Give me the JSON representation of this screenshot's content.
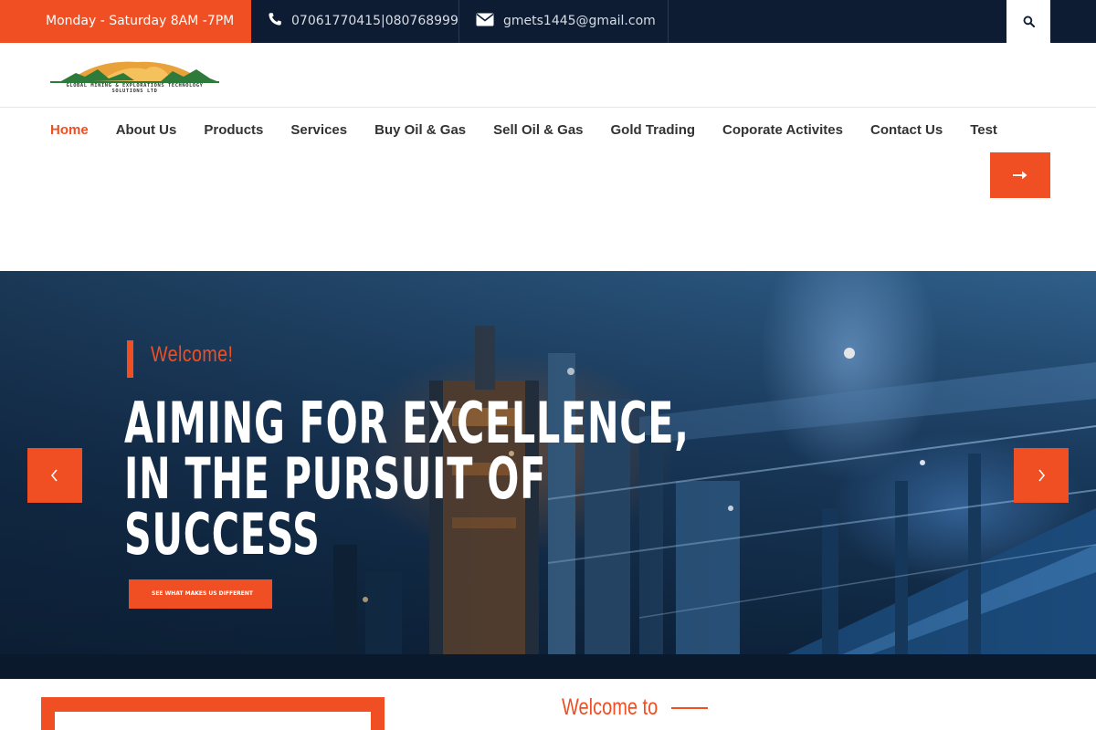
{
  "topbar": {
    "hours": "Monday - Saturday 8AM -7PM",
    "phone": "07061770415|080768999",
    "email": "gmets1445@gmail.com"
  },
  "logo": {
    "line1": "GLOBAL MINING & EXPLORATIONS TECHNOLOGY",
    "line2": "SOLUTIONS  LTD"
  },
  "nav": {
    "items": [
      {
        "label": "Home",
        "active": true
      },
      {
        "label": "About Us"
      },
      {
        "label": "Products"
      },
      {
        "label": "Services"
      },
      {
        "label": "Buy Oil & Gas"
      },
      {
        "label": "Sell Oil & Gas"
      },
      {
        "label": "Gold Trading"
      },
      {
        "label": "Coporate Activites"
      },
      {
        "label": "Contact Us"
      },
      {
        "label": "Test"
      }
    ]
  },
  "hero": {
    "eyebrow": "Welcome!",
    "headline": "AIMING FOR EXCELLENCE, IN THE PURSUIT OF SUCCESS",
    "cta": "SEE WHAT MAKES US DIFFERENT"
  },
  "about": {
    "heading": "Welcome to"
  },
  "colors": {
    "accent": "#f04e23",
    "topbar": "#0d1c32"
  },
  "icons": {
    "phone": "phone-icon",
    "email": "envelope-icon",
    "search": "search-icon",
    "nav_arrow": "arrow-right-icon",
    "prev": "chevron-left-icon",
    "next": "chevron-right-icon"
  }
}
